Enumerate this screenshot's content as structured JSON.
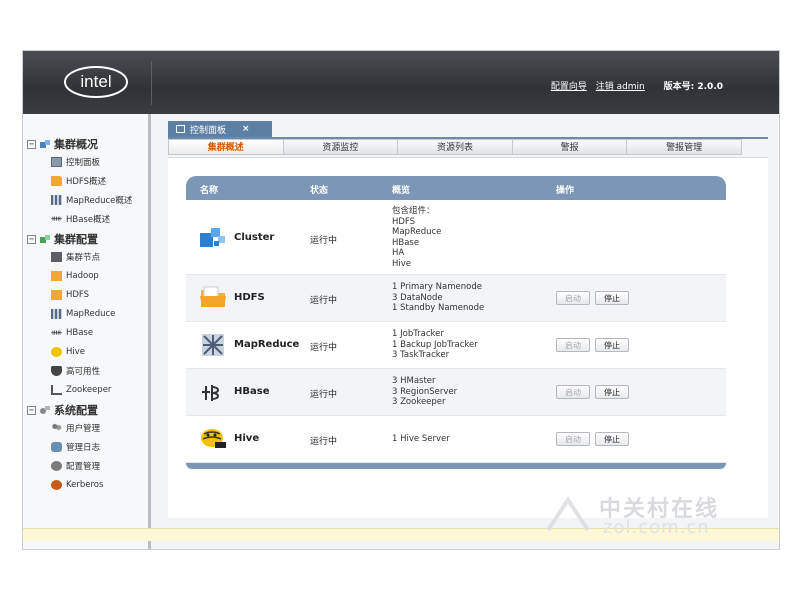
{
  "header": {
    "logo_text": "intel",
    "link_config_wizard": "配置向导",
    "link_logout": "注销 admin",
    "version": "版本号: 2.0.0"
  },
  "sidebar": {
    "sections": [
      {
        "label": "集群概况",
        "toggle": "−",
        "items": [
          {
            "label": "控制面板",
            "icon": "dashboard-icon"
          },
          {
            "label": "HDFS概述",
            "icon": "folder-icon"
          },
          {
            "label": "MapReduce概述",
            "icon": "grid-icon"
          },
          {
            "label": "HBase概述",
            "icon": "hbase-icon"
          }
        ]
      },
      {
        "label": "集群配置",
        "toggle": "−",
        "items": [
          {
            "label": "集群节点",
            "icon": "server-icon"
          },
          {
            "label": "Hadoop",
            "icon": "folder-icon"
          },
          {
            "label": "HDFS",
            "icon": "folder-icon"
          },
          {
            "label": "MapReduce",
            "icon": "grid-icon"
          },
          {
            "label": "HBase",
            "icon": "hbase-icon"
          },
          {
            "label": "Hive",
            "icon": "hive-icon"
          },
          {
            "label": "高可用性",
            "icon": "shield-icon"
          },
          {
            "label": "Zookeeper",
            "icon": "zookeeper-icon"
          }
        ]
      },
      {
        "label": "系统配置",
        "toggle": "−",
        "items": [
          {
            "label": "用户管理",
            "icon": "users-icon"
          },
          {
            "label": "管理日志",
            "icon": "log-icon"
          },
          {
            "label": "配置管理",
            "icon": "config-icon"
          },
          {
            "label": "Kerberos",
            "icon": "kerberos-icon"
          }
        ]
      }
    ]
  },
  "tabs": {
    "main_tab": "控制面板",
    "main_tab_close": "×",
    "subtabs": [
      "集群概述",
      "资源监控",
      "资源列表",
      "警报",
      "警报管理"
    ]
  },
  "table": {
    "headers": {
      "name": "名称",
      "status": "状态",
      "summary": "概览",
      "actions": "操作"
    },
    "rows": [
      {
        "name": "Cluster",
        "status": "运行中",
        "icon": "cluster-icon",
        "summary": [
          "包含组件：",
          "HDFS",
          "MapReduce",
          "HBase",
          "HA",
          "Hive"
        ],
        "has_actions": false
      },
      {
        "name": "HDFS",
        "status": "运行中",
        "icon": "folder-icon",
        "summary": [
          "1 Primary Namenode",
          "3 DataNode",
          "1 Standby Namenode"
        ],
        "has_actions": true
      },
      {
        "name": "MapReduce",
        "status": "运行中",
        "icon": "mapreduce-icon",
        "summary": [
          "1 JobTracker",
          "1 Backup JobTracker",
          "3 TaskTracker"
        ],
        "has_actions": true
      },
      {
        "name": "HBase",
        "status": "运行中",
        "icon": "hbase-icon",
        "summary": [
          "3 HMaster",
          "3 RegionServer",
          "3 Zookeeper"
        ],
        "has_actions": true
      },
      {
        "name": "Hive",
        "status": "运行中",
        "icon": "hive-icon",
        "summary": [
          "1 Hive Server"
        ],
        "has_actions": true
      }
    ],
    "start_label": "启动",
    "stop_label": "停止"
  },
  "watermark": {
    "cn": "中关村在线",
    "en": "zol.com.cn"
  },
  "colors": {
    "header_bg": "#3a3d41",
    "tab_active": "#5c7fa3",
    "table_header": "#7c97b5",
    "active_subtab": "#d45a00"
  }
}
